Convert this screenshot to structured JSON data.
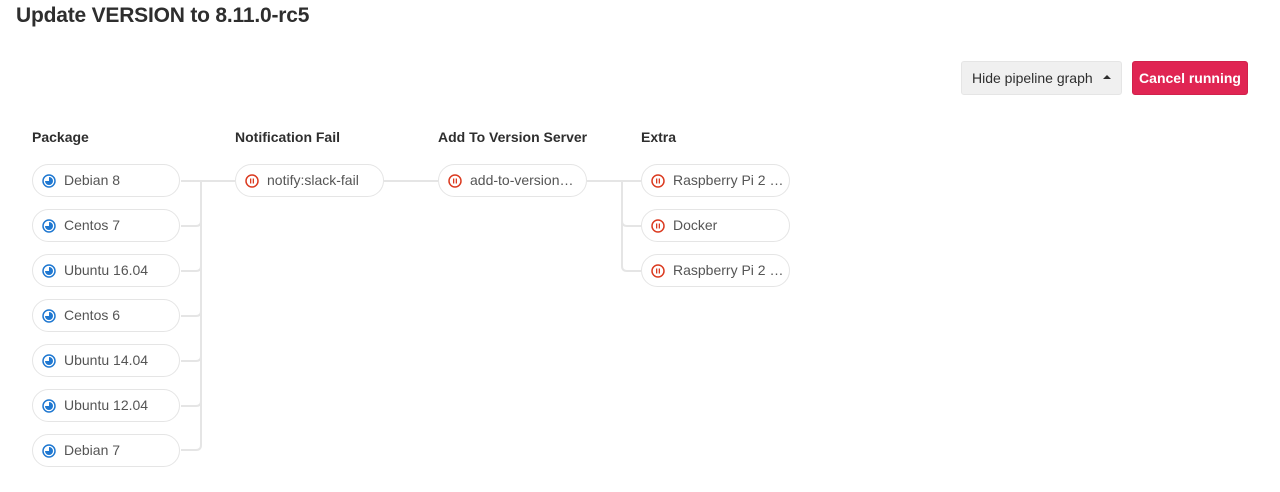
{
  "page": {
    "title": "Update VERSION to 8.11.0-rc5"
  },
  "toolbar": {
    "hide_graph_label": "Hide pipeline graph",
    "cancel_label": "Cancel running"
  },
  "colors": {
    "running": "#1f78d1",
    "manual": "#db3b21",
    "cancel_button": "#e02553",
    "connector": "#e5e5e5"
  },
  "stages": [
    {
      "title": "Package",
      "jobs": [
        {
          "name": "Debian 8",
          "status": "running-icon"
        },
        {
          "name": "Centos 7",
          "status": "running-icon"
        },
        {
          "name": "Ubuntu 16.04",
          "status": "running-icon"
        },
        {
          "name": "Centos 6",
          "status": "running-icon"
        },
        {
          "name": "Ubuntu 14.04",
          "status": "running-icon"
        },
        {
          "name": "Ubuntu 12.04",
          "status": "running-icon"
        },
        {
          "name": "Debian 7",
          "status": "running-icon"
        }
      ]
    },
    {
      "title": "Notification Fail",
      "jobs": [
        {
          "name": "notify:slack-fail",
          "status": "manual-icon"
        }
      ]
    },
    {
      "title": "Add To Version Server",
      "jobs": [
        {
          "name": "add-to-version…",
          "status": "manual-icon"
        }
      ]
    },
    {
      "title": "Extra",
      "jobs": [
        {
          "name": "Raspberry Pi 2 …",
          "status": "manual-icon"
        },
        {
          "name": "Docker",
          "status": "manual-icon"
        },
        {
          "name": "Raspberry Pi 2 …",
          "status": "manual-icon"
        }
      ]
    }
  ]
}
